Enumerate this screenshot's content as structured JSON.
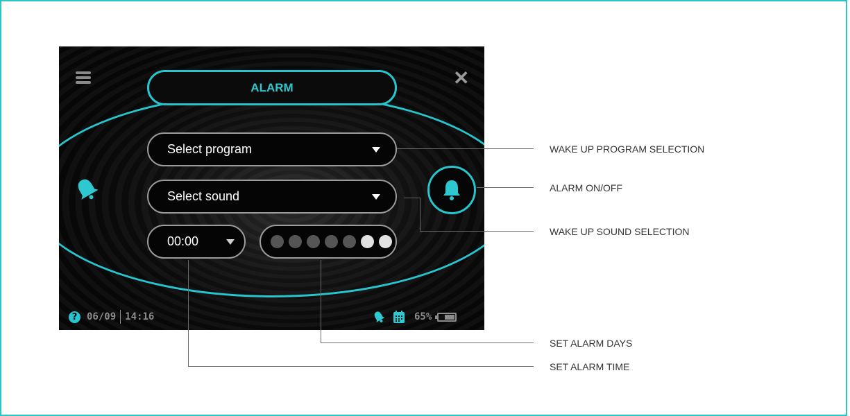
{
  "screen": {
    "title": "ALARM",
    "program_select": {
      "label": "Select program"
    },
    "sound_select": {
      "label": "Select sound"
    },
    "time_select": {
      "label": "00:00"
    },
    "days": [
      false,
      false,
      false,
      false,
      false,
      true,
      true
    ],
    "status": {
      "date": "06/09",
      "time": "14:16",
      "battery_pct": "65%",
      "battery_level": 0.65
    },
    "accent_color": "#27c6cf"
  },
  "callouts": {
    "wake_program": "WAKE UP PROGRAM SELECTION",
    "alarm_onoff": "ALARM ON/OFF",
    "wake_sound": "WAKE UP SOUND SELECTION",
    "alarm_days": "SET ALARM DAYS",
    "alarm_time": "SET ALARM TIME"
  }
}
